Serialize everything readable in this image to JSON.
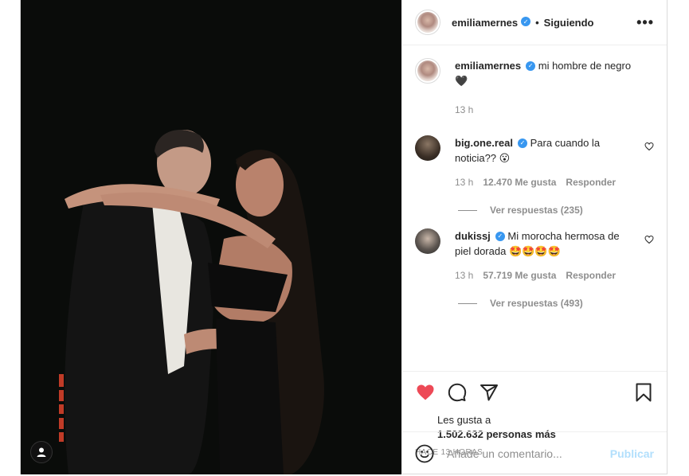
{
  "post": {
    "author": "emiliamernes",
    "follow_status": "Siguiendo",
    "more_label": "•••",
    "caption": {
      "username": "emiliamernes",
      "text": "mi hombre de negro",
      "emoji": "🖤",
      "time": "13 h"
    },
    "photo": {
      "date_stamp": "4 24 2 88"
    }
  },
  "comments": [
    {
      "username": "big.one.real",
      "verified": true,
      "text": "Para cuando la noticia?? 😮",
      "time": "13 h",
      "likes": "12.470 Me gusta",
      "reply": "Responder",
      "view_replies": "Ver respuestas (235)"
    },
    {
      "username": "dukissj",
      "verified": true,
      "text": "Mi morocha hermosa de piel dorada 🤩🤩🤩🤩",
      "time": "13 h",
      "likes": "57.719 Me gusta",
      "reply": "Responder",
      "view_replies": "Ver respuestas (493)"
    }
  ],
  "actions": {
    "liked": true,
    "like_color": "#ed4956",
    "icons": [
      "heart-icon",
      "comment-icon",
      "share-icon",
      "bookmark-icon"
    ]
  },
  "likes": {
    "prefix": "Les gusta a",
    "count_text": "1.502.632 personas más"
  },
  "timestamp": "HACE 13 HORAS",
  "composer": {
    "placeholder": "Añade un comentario...",
    "publish_label": "Publicar"
  }
}
